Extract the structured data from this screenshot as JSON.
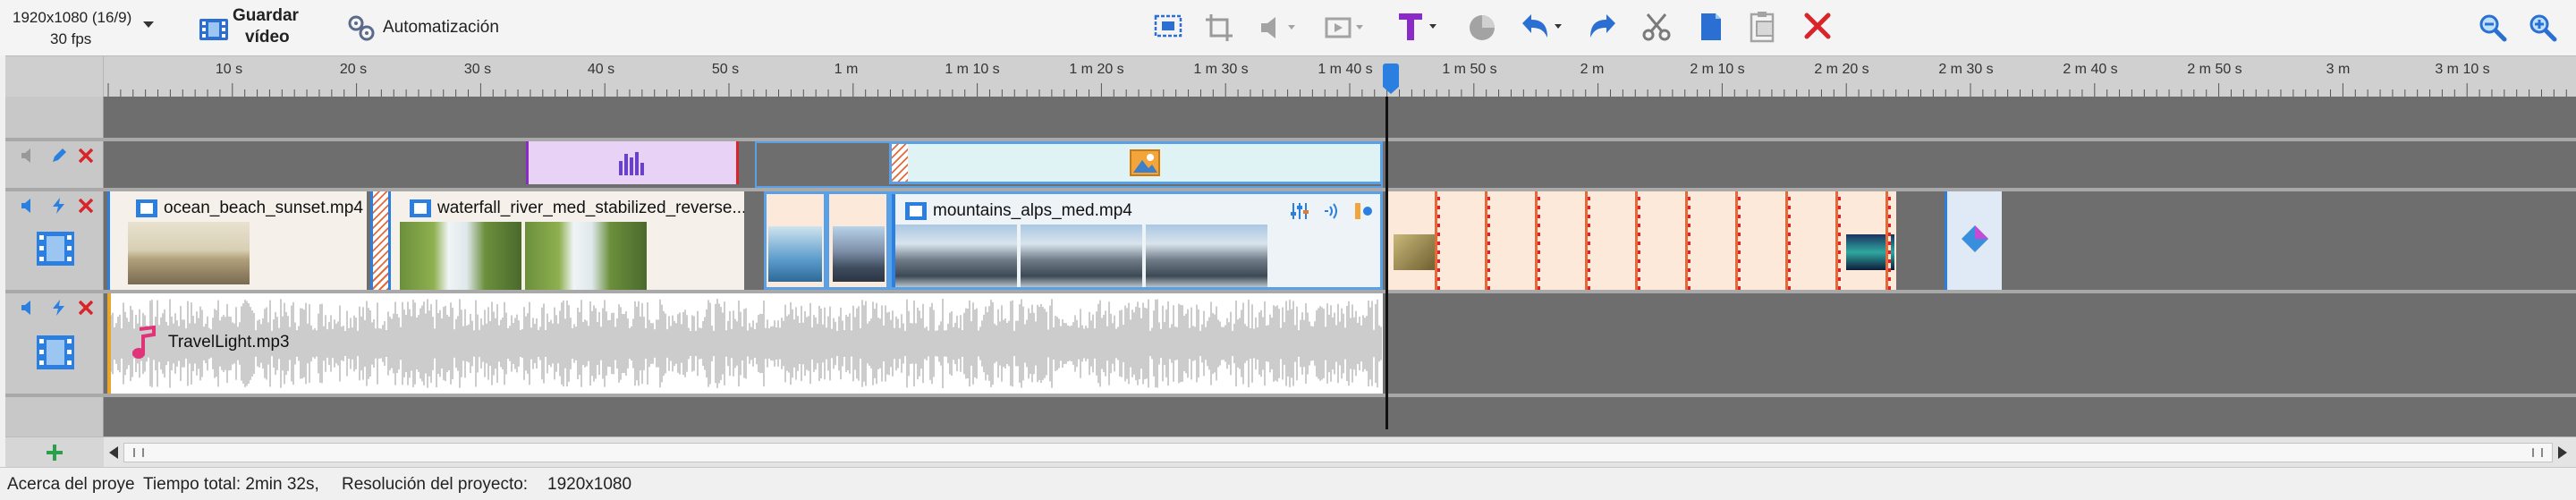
{
  "toolbar": {
    "resolution": "1920x1080 (16/9)",
    "fps": "30 fps",
    "save_line1": "Guardar",
    "save_line2": "vídeo",
    "automation_label": "Automatización"
  },
  "ruler": {
    "labels": [
      "10 s",
      "20 s",
      "30 s",
      "40 s",
      "50 s",
      "1 m",
      "1 m 10 s",
      "1 m 20 s",
      "1 m 30 s",
      "1 m 40 s",
      "1 m 50 s",
      "2 m",
      "2 m 10 s",
      "2 m 20 s",
      "2 m 30 s",
      "2 m 40 s",
      "2 m 50 s",
      "3 m",
      "3 m 10 s"
    ]
  },
  "tracks": {
    "video": {
      "clips": [
        {
          "name": "ocean_beach_sunset.mp4"
        },
        {
          "name": "waterfall_river_med_stabilized_reverse..."
        },
        {
          "name": "mountains_alps_med.mp4"
        }
      ]
    },
    "audio": {
      "clip_name": "TravelLight.mp3"
    }
  },
  "status": {
    "about": "Acerca del proye",
    "total_time": "Tiempo total: 2min 32s,",
    "resolution_label": "Resolución del proyecto:",
    "resolution_value": "1920x1080"
  },
  "colors": {
    "accent_blue": "#3b8fdc",
    "clip_selected": "#5aa0e6",
    "music_clip_bg": "#e8d2f5",
    "image_clip_bg": "#dff3f4",
    "transition_bg": "#fde9d9",
    "delete_red": "#d8242a"
  }
}
